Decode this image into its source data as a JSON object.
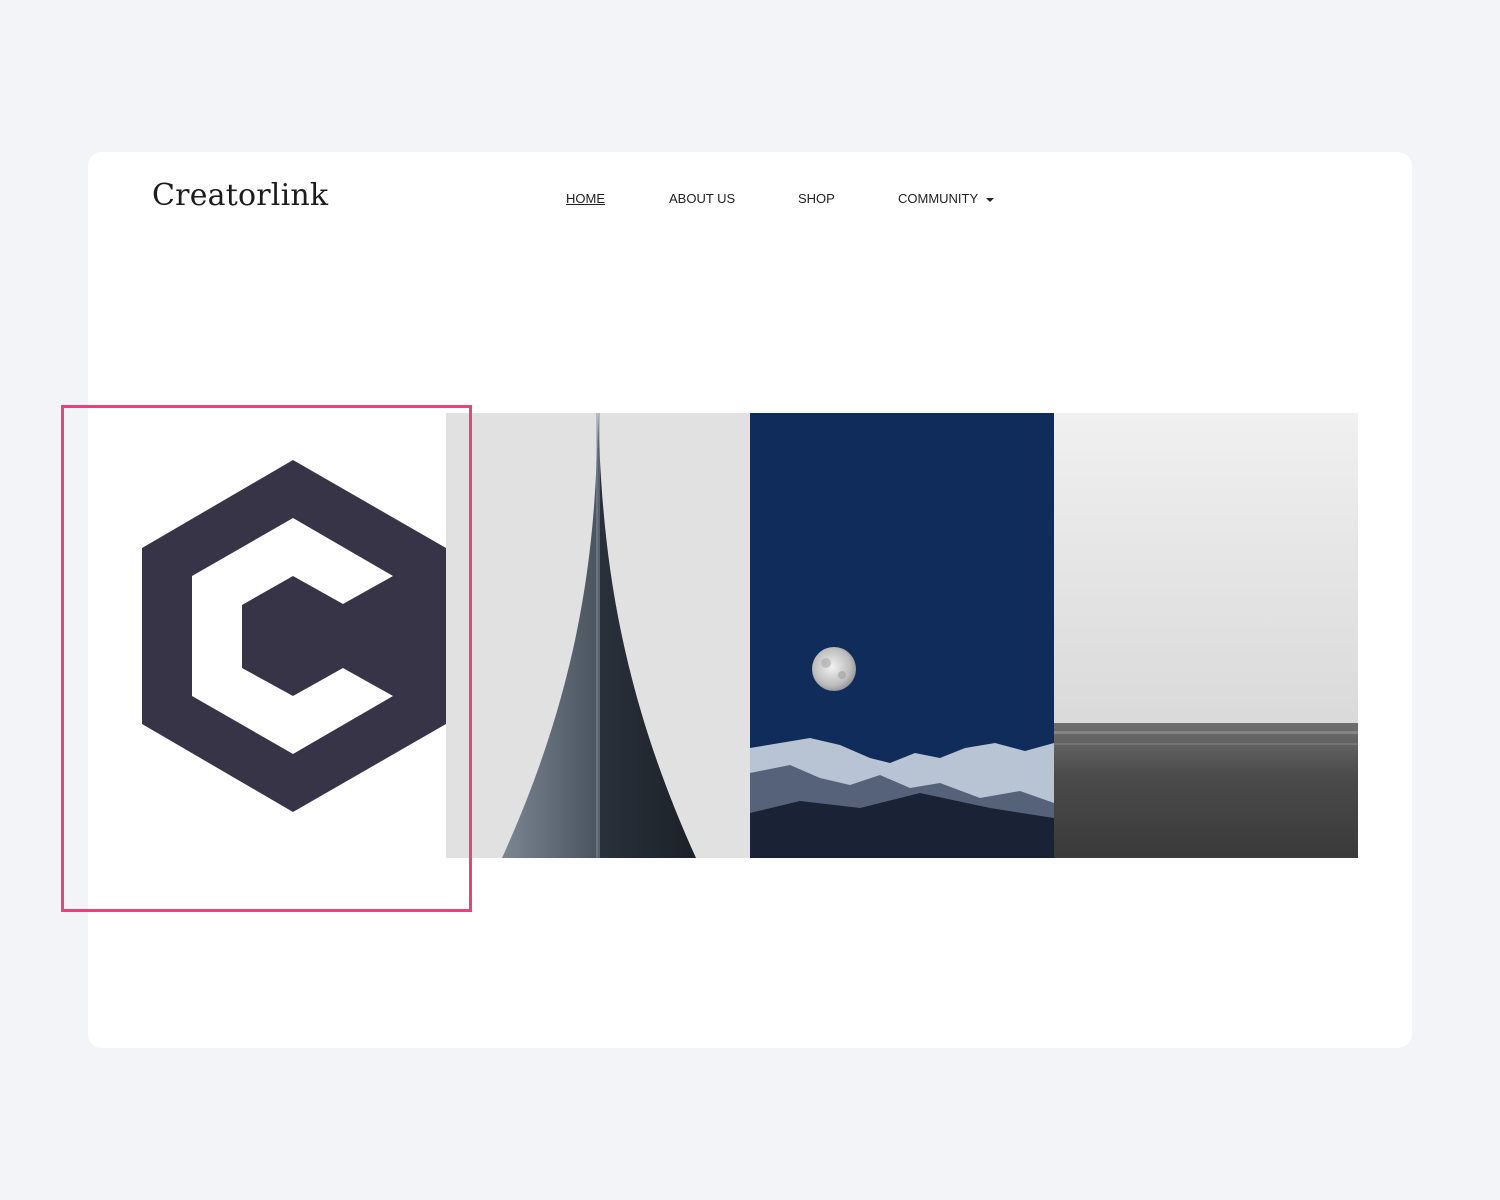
{
  "header": {
    "brand": "Creatorlink",
    "nav": [
      {
        "label": "HOME",
        "active": true
      },
      {
        "label": "ABOUT US",
        "active": false
      },
      {
        "label": "SHOP",
        "active": false
      },
      {
        "label": "COMMUNITY",
        "active": false,
        "has_dropdown": true
      }
    ]
  },
  "gallery": {
    "logo_icon": "creatorlink-hexagon-c-logo",
    "images": [
      {
        "icon": "spire-image"
      },
      {
        "icon": "moon-mountains-image"
      },
      {
        "icon": "sea-horizon-image"
      }
    ]
  },
  "colors": {
    "page_background": "#f3f4f8",
    "card_background": "#ffffff",
    "logo_color": "#363446",
    "highlight_border": "#e8437a",
    "night_sky": "#102c5a"
  }
}
